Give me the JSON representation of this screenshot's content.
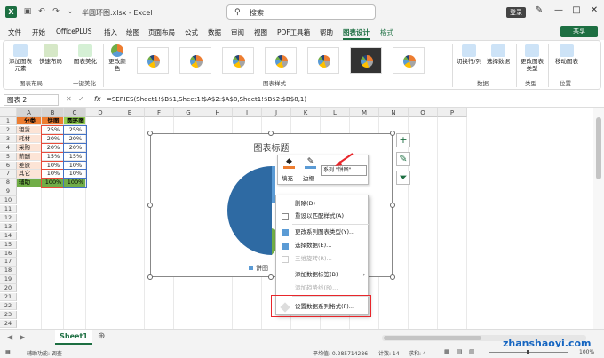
{
  "app": {
    "file_title": "半圆环图.xlsx  -  Excel",
    "search_placeholder": "搜索",
    "login": "登录",
    "share": "共享"
  },
  "menu": [
    "文件",
    "开始",
    "OfficePLUS",
    "插入",
    "绘图",
    "页面布局",
    "公式",
    "数据",
    "审阅",
    "视图",
    "PDF工具箱",
    "帮助",
    "图表设计",
    "格式"
  ],
  "ribbon": {
    "add_element": "添加图表元素",
    "quick_layout": "快速布局",
    "chart_beautify": "图表美化",
    "change_colors": "更改颜色",
    "group_layout": "图表布局",
    "group_beautify": "一键美化",
    "group_styles": "图表样式",
    "switch_row_col": "切换行/列",
    "select_data": "选择数据",
    "group_data": "数据",
    "change_type": "更改图表类型",
    "group_type": "类型",
    "move_chart": "移动图表",
    "group_location": "位置"
  },
  "formula_bar": {
    "name_box": "图表 2",
    "fx": "fx",
    "formula": "=SERIES(Sheet1!$B$1,Sheet1!$A$2:$A$8,Sheet1!$B$2:$B$8,1)"
  },
  "columns": [
    "A",
    "B",
    "C",
    "D",
    "E",
    "F",
    "G",
    "H",
    "I",
    "J",
    "K",
    "L",
    "M",
    "N",
    "O",
    "P"
  ],
  "rows": [
    "1",
    "2",
    "3",
    "4",
    "5",
    "6",
    "7",
    "8",
    "9",
    "10",
    "11",
    "12",
    "13",
    "14",
    "15",
    "16",
    "17",
    "18",
    "19",
    "20",
    "21",
    "22",
    "23",
    "24"
  ],
  "table": {
    "headers": [
      "分类",
      "饼图",
      "圆环图"
    ],
    "data": [
      [
        "租赁",
        "25%",
        "25%"
      ],
      [
        "耗材",
        "20%",
        "20%"
      ],
      [
        "采购",
        "20%",
        "20%"
      ],
      [
        "薪酬",
        "15%",
        "15%"
      ],
      [
        "差旅",
        "10%",
        "10%"
      ],
      [
        "其它",
        "10%",
        "10%"
      ],
      [
        "辅助",
        "100%",
        "100%"
      ]
    ]
  },
  "chart": {
    "title": "图表标题",
    "legend": "饼图"
  },
  "minitoolbar": {
    "fill": "填充",
    "outline": "边框",
    "series_select": "系列 \"饼图\""
  },
  "context_menu": {
    "items": [
      {
        "label": "删除(D)",
        "disabled": false
      },
      {
        "label": "重设以匹配样式(A)",
        "disabled": false
      },
      {
        "label": "更改系列图表类型(Y)...",
        "disabled": false
      },
      {
        "label": "选择数据(E)...",
        "disabled": false
      },
      {
        "label": "三维旋转(R)...",
        "disabled": true
      },
      {
        "label": "添加数据标签(B)",
        "disabled": false
      },
      {
        "label": "添加趋势线(R)...",
        "disabled": true
      },
      {
        "label": "设置数据系列格式(F)...",
        "disabled": false
      }
    ]
  },
  "sheet": {
    "tab": "Sheet1"
  },
  "status": {
    "accessibility": "辅助功能: 调查",
    "average": "平均值: 0.285714286",
    "count": "计数: 14",
    "sum": "求和: 4",
    "zoom": "100%"
  },
  "watermark": "zhanshaoyi.com"
}
